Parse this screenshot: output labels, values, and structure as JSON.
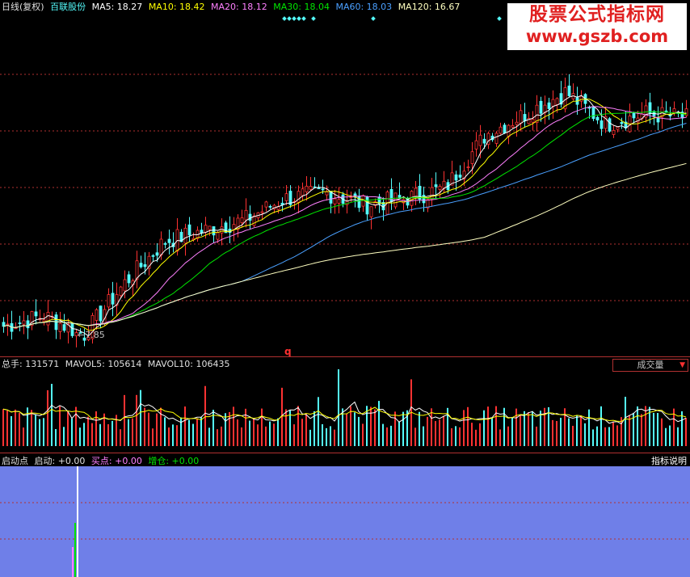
{
  "price_header": {
    "period": "日线(复权)",
    "stock_name": "百联股份",
    "ma5": "MA5: 18.27",
    "ma10": "MA10: 18.42",
    "ma20": "MA20: 18.12",
    "ma30": "MA30: 18.04",
    "ma60": "MA60: 18.03",
    "ma120": "MA120: 16.67"
  },
  "watermark": {
    "line1": "股票公式指标网",
    "line2": "www.gszb.com"
  },
  "low_marker": "7.85",
  "q_marker": "q",
  "volume_header": {
    "total": "总手: 131571",
    "mavol5": "MAVOL5: 105614",
    "mavol10": "MAVOL10: 106435",
    "dropdown": "成交量"
  },
  "indicator_header": {
    "name": "启动点",
    "qidong": "启动: +0.00",
    "maidian": "买点: +0.00",
    "zengcang": "增仓: +0.00",
    "help": "指标说明"
  },
  "colors": {
    "up": "#ff3232",
    "down": "#54fcfc",
    "ma5": "#ffffff",
    "ma10": "#ffff00",
    "ma20": "#ff80ff",
    "ma30": "#00e600",
    "ma60": "#4aa0ff",
    "ma120": "#ffffc0",
    "indicator_bg": "#6f7fe8"
  },
  "chart_data": {
    "type": "candlestick",
    "price_range_estimate": [
      7.5,
      23
    ],
    "trend_anchor_closes": [
      8.5,
      9.0,
      8.1,
      10.5,
      12.5,
      13.0,
      13.5,
      14.5,
      14.8,
      14.2,
      14.5,
      15.0,
      17.5,
      18.5,
      19.5,
      18.0,
      18.5,
      18.3
    ],
    "low_point": 7.85,
    "moving_averages": [
      "MA5",
      "MA10",
      "MA20",
      "MA30",
      "MA60",
      "MA120"
    ]
  }
}
